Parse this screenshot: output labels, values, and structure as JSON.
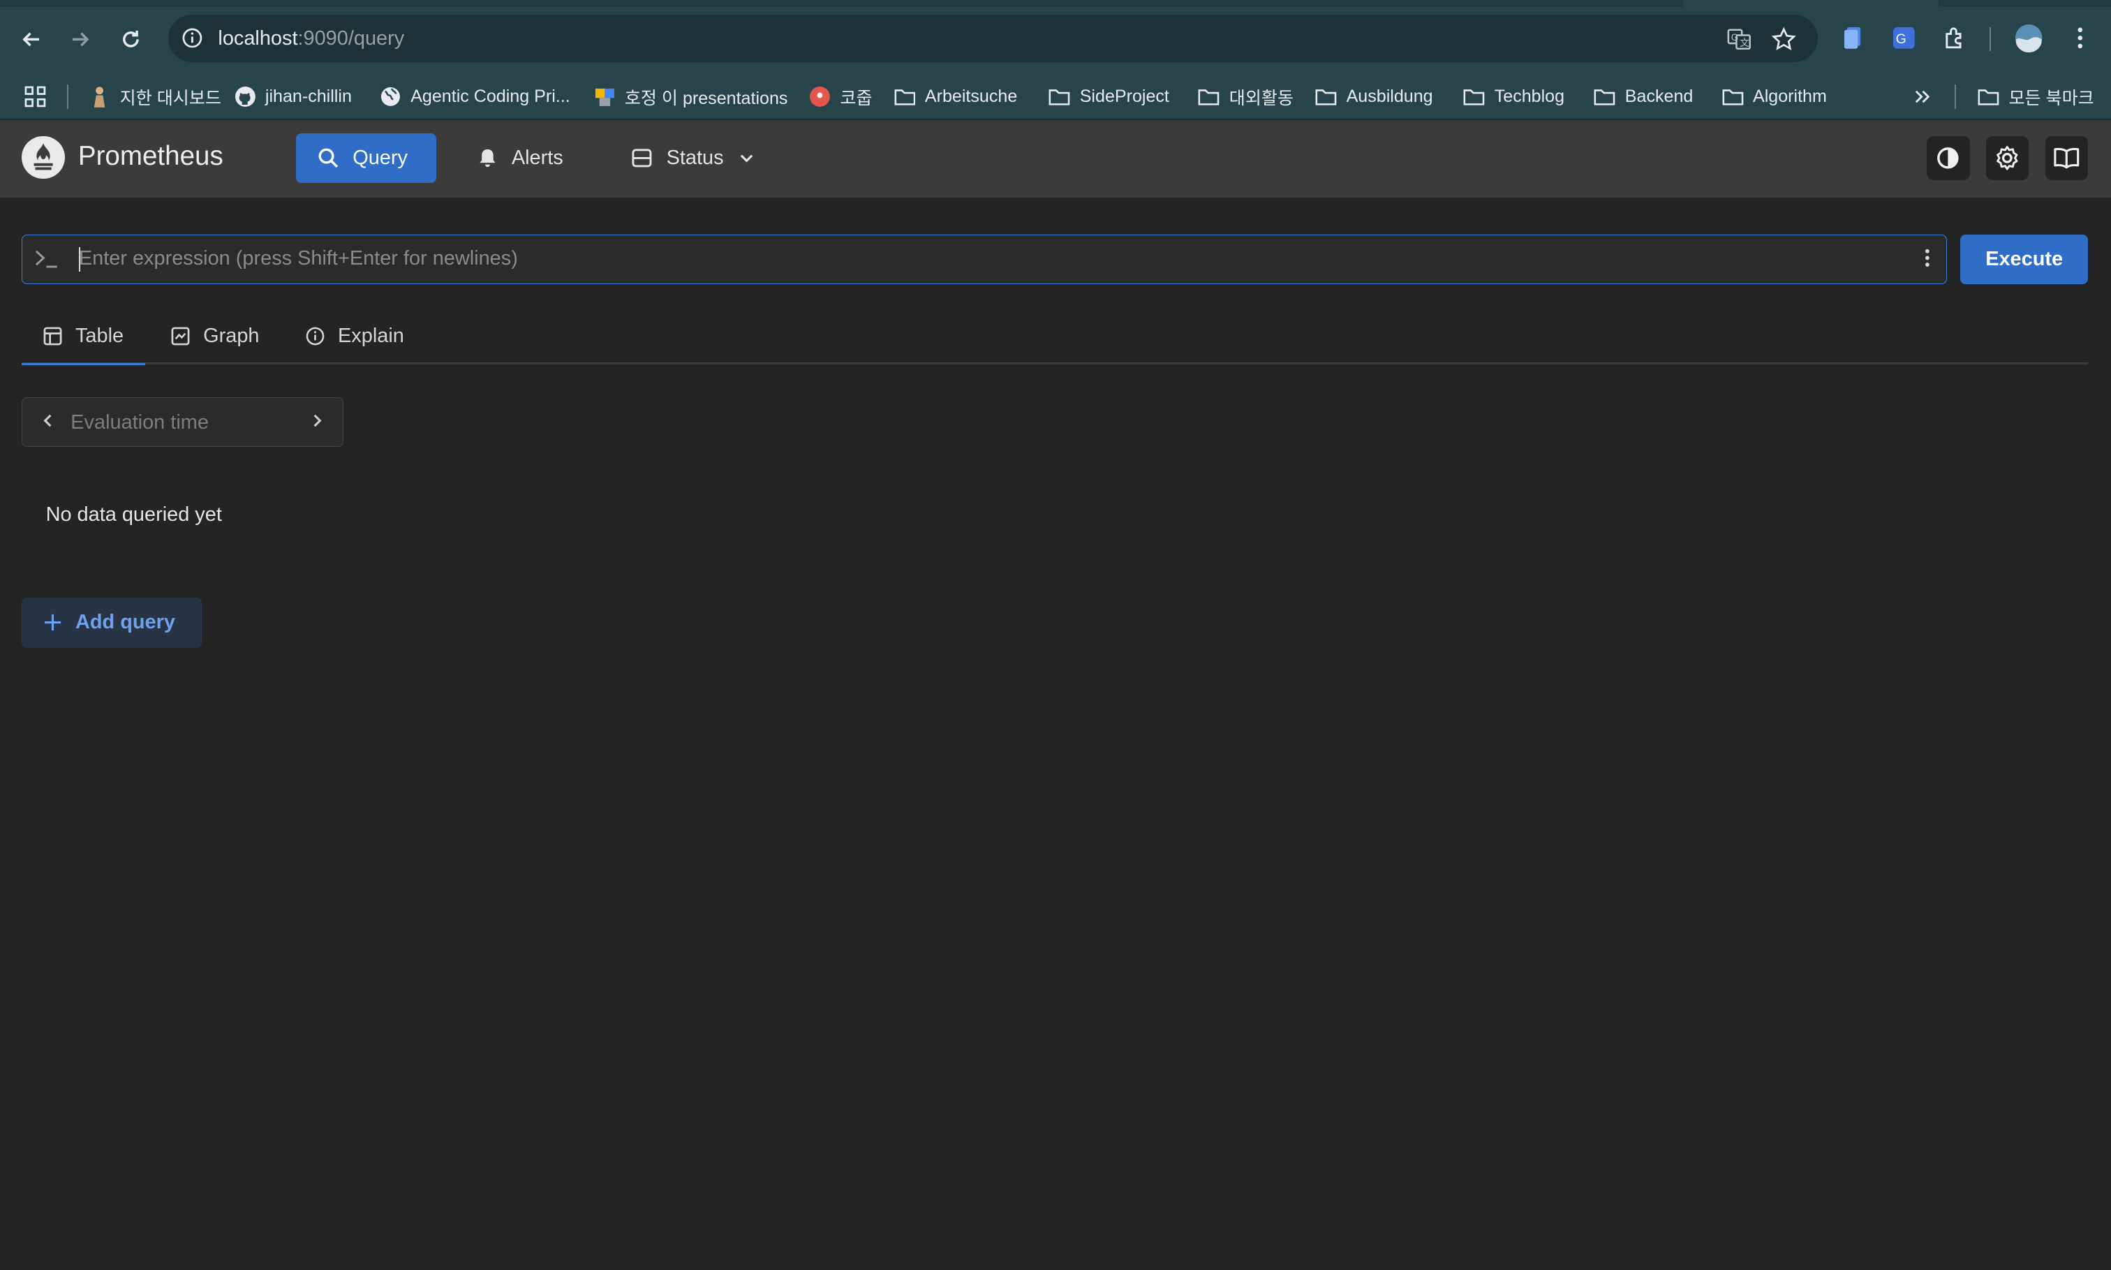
{
  "browser": {
    "url_host": "localhost",
    "url_path": ":9090/query",
    "bookmarks": [
      {
        "label": "지한 대시보드",
        "icon": "person-icon"
      },
      {
        "label": "jihan-chillin",
        "icon": "github-icon"
      },
      {
        "label": "Agentic Coding Pri...",
        "icon": "globe-icon"
      },
      {
        "label": "호정 이 presentations",
        "icon": "slides-icon"
      },
      {
        "label": "코줍",
        "icon": "red-badge-icon"
      },
      {
        "label": "Arbeitsuche",
        "icon": "folder-icon"
      },
      {
        "label": "SideProject",
        "icon": "folder-icon"
      },
      {
        "label": "대외활동",
        "icon": "folder-icon"
      },
      {
        "label": "Ausbildung",
        "icon": "folder-icon"
      },
      {
        "label": "Techblog",
        "icon": "folder-icon"
      },
      {
        "label": "Backend",
        "icon": "folder-icon"
      },
      {
        "label": "Algorithm",
        "icon": "folder-icon"
      }
    ],
    "all_bookmarks_label": "모든 북마크"
  },
  "app": {
    "brand": "Prometheus",
    "nav": {
      "query": "Query",
      "alerts": "Alerts",
      "status": "Status"
    }
  },
  "query": {
    "placeholder": "Enter expression (press Shift+Enter for newlines)",
    "execute_label": "Execute",
    "tabs": {
      "table": "Table",
      "graph": "Graph",
      "explain": "Explain"
    },
    "active_tab": "Table",
    "eval_time_placeholder": "Evaluation time",
    "empty_message": "No data queried yet",
    "add_query_label": "Add query"
  },
  "colors": {
    "accent": "#2f6dc7",
    "page_background": "#242424",
    "header_background": "#3b3b3c",
    "browser_chrome": "#27444a"
  }
}
